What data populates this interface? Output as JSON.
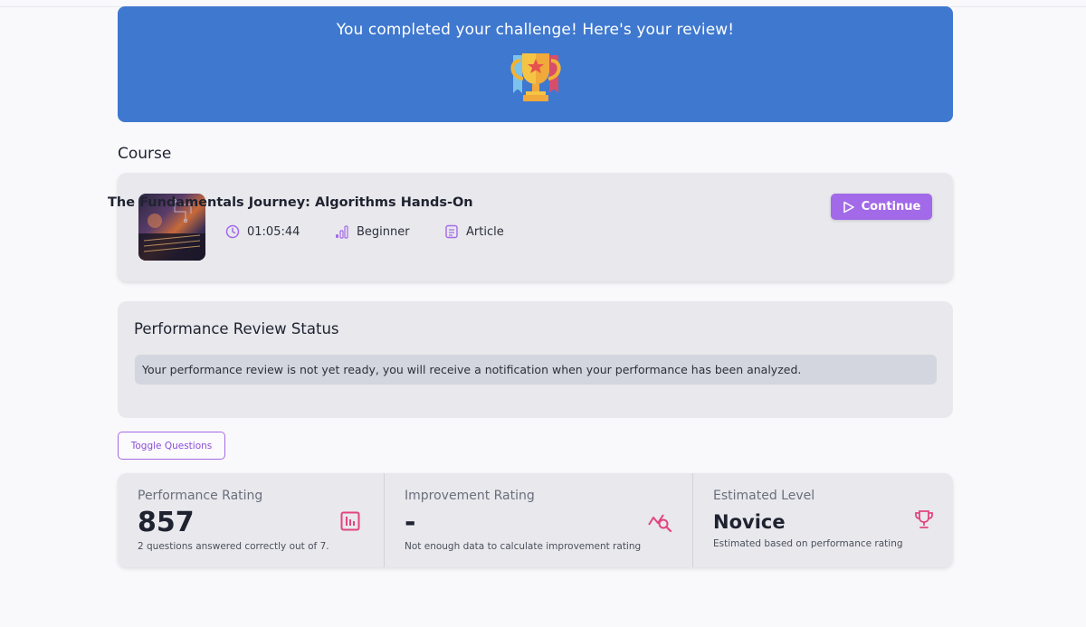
{
  "banner": {
    "title": "You completed your challenge! Here's your review!",
    "icon": "trophy-icon"
  },
  "course_section": {
    "label": "Course",
    "title": "The Fundamentals Journey: Algorithms Hands-On",
    "duration": "01:05:44",
    "level": "Beginner",
    "type": "Article",
    "continue_label": "Continue"
  },
  "performance_status": {
    "title": "Performance Review Status",
    "message": "Your performance review is not yet ready, you will receive a notification when your performance has been analyzed."
  },
  "toggle_questions_label": "Toggle Questions",
  "stats": [
    {
      "label": "Performance Rating",
      "value": "857",
      "sub": "2 questions answered correctly out of 7.",
      "icon": "bar-chart-icon"
    },
    {
      "label": "Improvement Rating",
      "value": "-",
      "sub": "Not enough data to calculate improvement rating",
      "icon": "trend-search-icon"
    },
    {
      "label": "Estimated Level",
      "value": "Novice",
      "sub": "Estimated based on performance rating",
      "icon": "trophy-outline-icon"
    }
  ],
  "colors": {
    "banner": "#3f78cf",
    "accent_purple": "#a26ae8",
    "accent_pink": "#e2457f"
  }
}
